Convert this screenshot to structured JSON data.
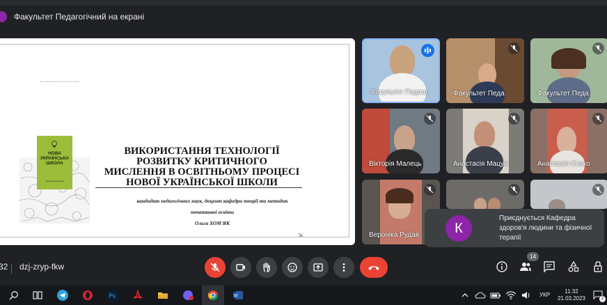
{
  "header": {
    "presenter_label": "Факультет Педагогічний на екрані"
  },
  "slide": {
    "small_caption": "Всеукраїнський науковий семінар",
    "book_title": "НОВА УКРАЇНСЬКА ШКОЛА",
    "book_subtitle": "практичне керівництво",
    "title_lines": [
      "ВИКОРИСТАННЯ ТЕХНОЛОГІЇ",
      "РОЗВИТКУ КРИТИЧНОГО",
      "МИСЛЕННЯ В ОСВІТНЬОМУ ПРОЦЕСІ",
      "НОВОЇ УКРАЇНСЬКОЇ ШКОЛИ"
    ],
    "author_lines": [
      "кандидат педагогічних наук, доцент кафедри теорії та методик",
      "початкової освіти",
      "Ольга ХОМ'ЯК"
    ]
  },
  "participants": [
    {
      "name": "Факультет Педаш",
      "speaking": true
    },
    {
      "name": "Факультет Педа",
      "speaking": false
    },
    {
      "name": "Факультет Педа",
      "speaking": false
    },
    {
      "name": "Вікторія Малець",
      "speaking": false
    },
    {
      "name": "Анастасія Мацун",
      "speaking": false
    },
    {
      "name": "Анастасія Скако",
      "speaking": false
    },
    {
      "name": "Вероніка Рудав",
      "speaking": false
    },
    {
      "name": "",
      "speaking": false
    },
    {
      "name": "",
      "speaking": false
    }
  ],
  "toast": {
    "avatar_letter": "К",
    "message": "Приєднується Кафедра здоров'я людини та фізичної терапії"
  },
  "bottombar": {
    "time_partial": "32",
    "meeting_code": "dzj-zryp-fkw",
    "people_count": "14"
  },
  "taskbar": {
    "language": "УКР",
    "time": "11:32",
    "date": "21.03.2023",
    "notification_count": "2"
  },
  "colors": {
    "background": "#202124",
    "accent": "#8ab4f8",
    "danger": "#ea4335",
    "avatar_purple": "#8e24aa",
    "book_green": "#9bbd3a"
  }
}
